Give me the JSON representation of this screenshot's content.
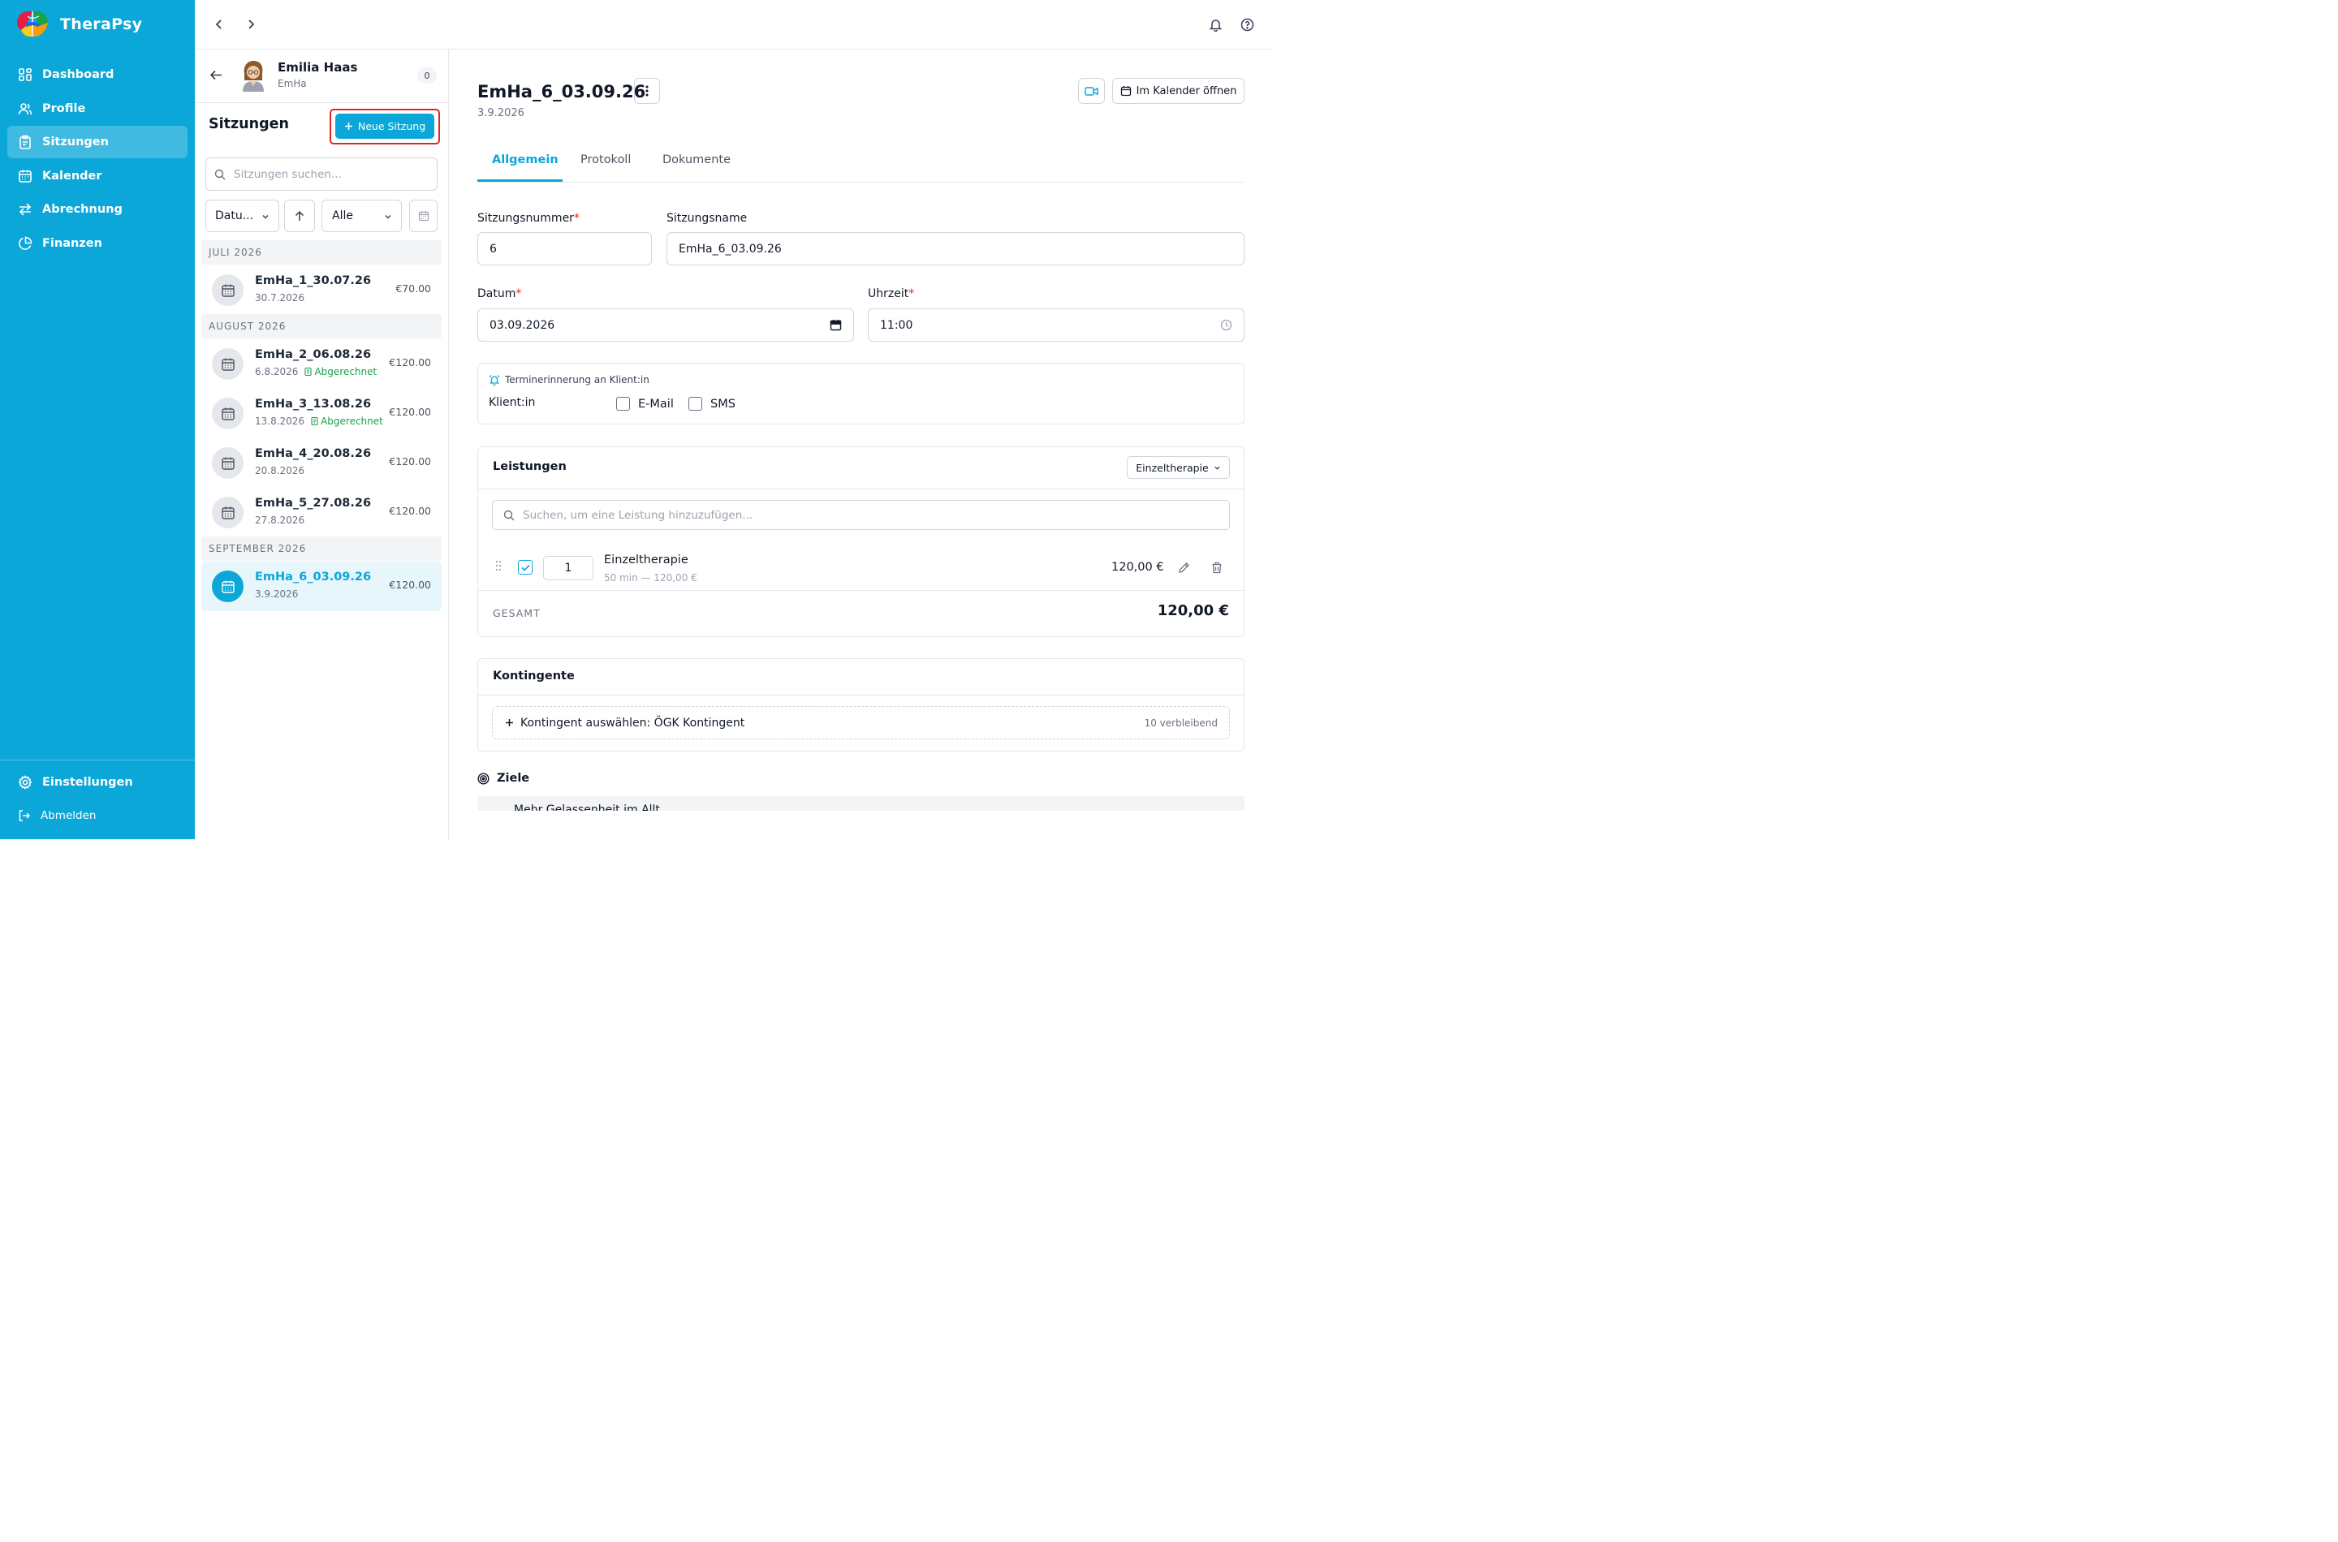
{
  "app": {
    "name": "TheraPsy"
  },
  "sidebar": {
    "items": [
      {
        "label": "Dashboard",
        "icon": "dashboard-icon"
      },
      {
        "label": "Profile",
        "icon": "users-icon"
      },
      {
        "label": "Sitzungen",
        "icon": "clipboard-icon",
        "active": true
      },
      {
        "label": "Kalender",
        "icon": "calendar-icon"
      },
      {
        "label": "Abrechnung",
        "icon": "arrows-icon"
      },
      {
        "label": "Finanzen",
        "icon": "pie-chart-icon"
      }
    ],
    "settings": "Einstellungen",
    "logout": "Abmelden"
  },
  "client": {
    "name": "Emilia Haas",
    "short": "EmHa",
    "count": "0"
  },
  "sessions_panel": {
    "title": "Sitzungen",
    "new_button": "Neue Sitzung",
    "search_placeholder": "Sitzungen suchen...",
    "sort_select": "Datu...",
    "filter_select": "Alle",
    "groups": [
      {
        "label": "JULI 2026"
      },
      {
        "label": "AUGUST 2026"
      },
      {
        "label": "SEPTEMBER 2026"
      }
    ],
    "sessions": [
      {
        "name": "EmHa_1_30.07.26",
        "date": "30.7.2026",
        "price": "€70.00",
        "status": ""
      },
      {
        "name": "EmHa_2_06.08.26",
        "date": "6.8.2026",
        "price": "€120.00",
        "status": "Abgerechnet"
      },
      {
        "name": "EmHa_3_13.08.26",
        "date": "13.8.2026",
        "price": "€120.00",
        "status": "Abgerechnet"
      },
      {
        "name": "EmHa_4_20.08.26",
        "date": "20.8.2026",
        "price": "€120.00",
        "status": ""
      },
      {
        "name": "EmHa_5_27.08.26",
        "date": "27.8.2026",
        "price": "€120.00",
        "status": ""
      },
      {
        "name": "EmHa_6_03.09.26",
        "date": "3.9.2026",
        "price": "€120.00",
        "status": "",
        "active": true
      }
    ]
  },
  "detail": {
    "title": "EmHa_6_03.09.26",
    "date": "3.9.2026",
    "calendar_button": "Im Kalender öffnen",
    "tabs": [
      "Allgemein",
      "Protokoll",
      "Dokumente"
    ],
    "fields": {
      "number_label": "Sitzungsnummer",
      "number_value": "6",
      "name_label": "Sitzungsname",
      "name_value": "EmHa_6_03.09.26",
      "date_label": "Datum",
      "date_value": "03.09.2026",
      "time_label": "Uhrzeit",
      "time_value": "11:00",
      "required_mark": "*"
    },
    "reminder": {
      "heading": "Terminerinnerung an Klient:in",
      "client_label": "Klient:in",
      "email_label": "E-Mail",
      "sms_label": "SMS"
    },
    "services": {
      "title": "Leistungen",
      "type_select": "Einzeltherapie",
      "search_placeholder": "Suchen, um eine Leistung hinzuzufügen...",
      "items": [
        {
          "qty": "1",
          "name": "Einzeltherapie",
          "meta": "50 min — 120,00 €",
          "price": "120,00 €"
        }
      ],
      "total_label": "GESAMT",
      "total_value": "120,00 €"
    },
    "quota": {
      "title": "Kontingente",
      "select_label": "Kontingent auswählen: ÖGK Kontingent",
      "remaining": "10 verbleibend"
    },
    "goals": {
      "title": "Ziele",
      "first_item_partial": "Mehr Gelassenheit im Allt"
    }
  },
  "colors": {
    "brand": "#0ba7d9",
    "success": "#16a34a",
    "highlight": "#dc2626"
  }
}
